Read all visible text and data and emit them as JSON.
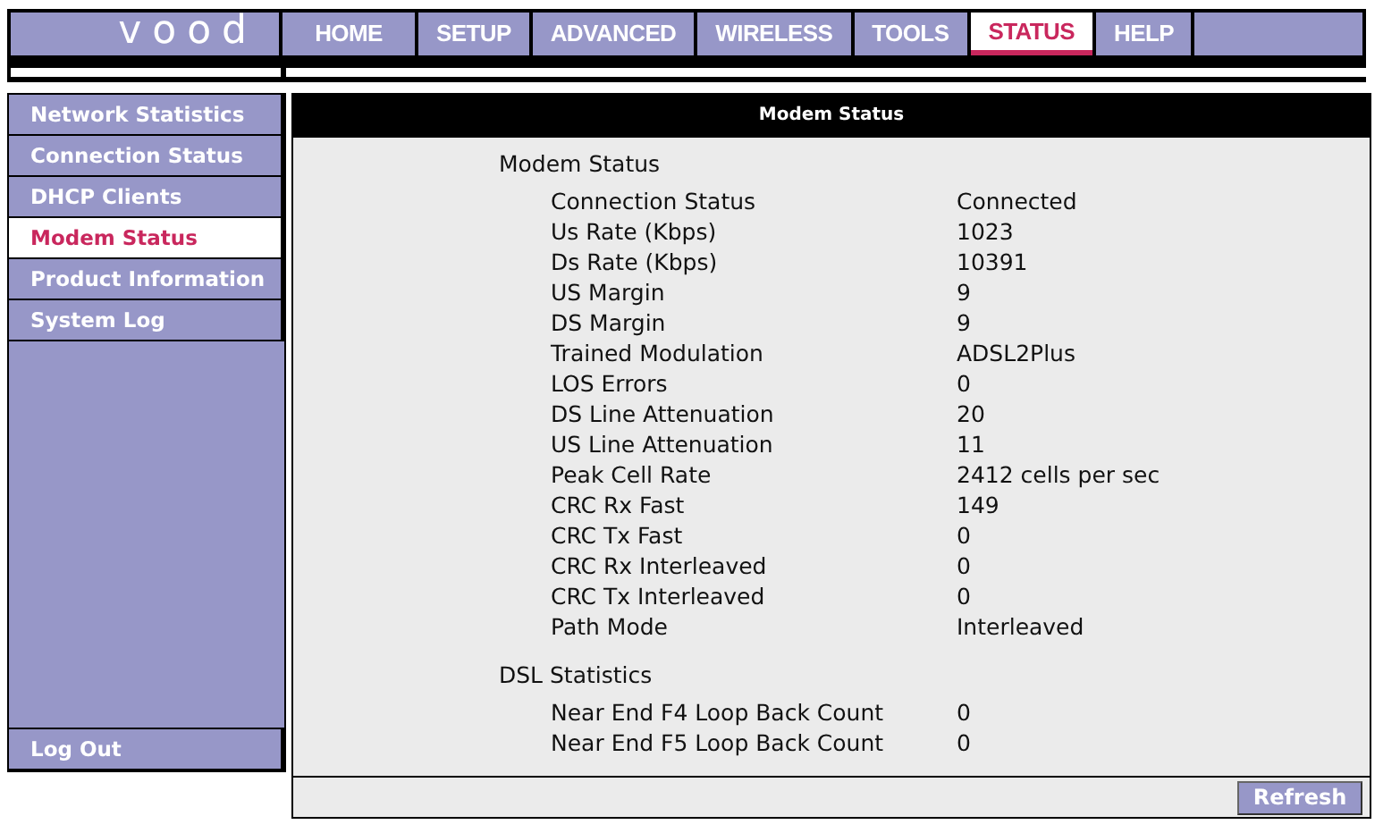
{
  "logo": "vood",
  "nav": [
    {
      "label": "HOME",
      "selected": false
    },
    {
      "label": "SETUP",
      "selected": false
    },
    {
      "label": "ADVANCED",
      "selected": false
    },
    {
      "label": "WIRELESS",
      "selected": false
    },
    {
      "label": "TOOLS",
      "selected": false
    },
    {
      "label": "STATUS",
      "selected": true
    },
    {
      "label": "HELP",
      "selected": false
    }
  ],
  "sidebar": {
    "items": [
      {
        "label": "Network Statistics",
        "selected": false
      },
      {
        "label": "Connection Status",
        "selected": false
      },
      {
        "label": "DHCP Clients",
        "selected": false
      },
      {
        "label": "Modem Status",
        "selected": true
      },
      {
        "label": "Product Information",
        "selected": false
      },
      {
        "label": "System Log",
        "selected": false
      }
    ],
    "logout": "Log Out"
  },
  "panel": {
    "title": "Modem Status",
    "sections": [
      {
        "heading": "Modem Status",
        "rows": [
          [
            "Connection Status",
            "Connected"
          ],
          [
            "Us Rate (Kbps)",
            "1023"
          ],
          [
            "Ds Rate (Kbps)",
            "10391"
          ],
          [
            "US Margin",
            "9"
          ],
          [
            "DS Margin",
            "9"
          ],
          [
            "Trained Modulation",
            "ADSL2Plus"
          ],
          [
            "LOS Errors",
            "0"
          ],
          [
            "DS Line Attenuation",
            "20"
          ],
          [
            "US Line Attenuation",
            "11"
          ],
          [
            "Peak Cell Rate",
            "2412 cells per sec"
          ],
          [
            "CRC Rx Fast",
            "149"
          ],
          [
            "CRC Tx Fast",
            "0"
          ],
          [
            "CRC Rx Interleaved",
            "0"
          ],
          [
            "CRC Tx Interleaved",
            "0"
          ],
          [
            "Path Mode",
            "Interleaved"
          ]
        ]
      },
      {
        "heading": "DSL Statistics",
        "rows": [
          [
            "Near End F4 Loop Back Count",
            "0"
          ],
          [
            "Near End F5 Loop Back Count",
            "0"
          ]
        ]
      }
    ],
    "button": "Refresh"
  }
}
